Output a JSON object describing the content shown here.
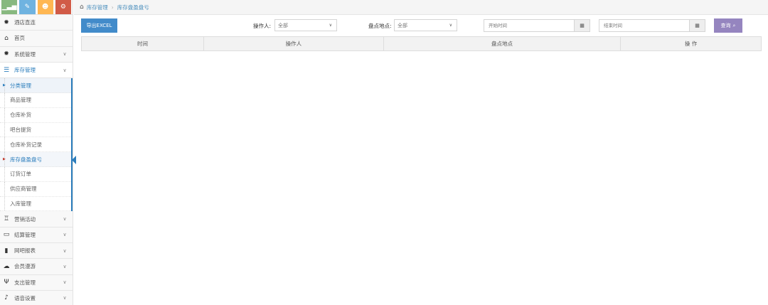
{
  "colors": {
    "accent": "#2b7dbc",
    "excel_button": "#428bca",
    "query_button": "#9585bf",
    "shortcut_green": "#87b87f",
    "shortcut_blue": "#6fb3e0",
    "shortcut_orange": "#ffb752",
    "shortcut_red": "#d15b47"
  },
  "shortcuts": [
    {
      "icon": "bar-chart-icon",
      "glyph": "▁▃▅"
    },
    {
      "icon": "pencil-icon",
      "glyph": "✎"
    },
    {
      "icon": "users-icon",
      "glyph": "☻"
    },
    {
      "icon": "cogs-icon",
      "glyph": "⚙"
    }
  ],
  "sidebar": {
    "top_items": [
      {
        "label": "酒店直连",
        "icon": "gear-icon",
        "glyph": "✹"
      },
      {
        "label": "首页",
        "icon": "home-icon",
        "glyph": "⌂"
      },
      {
        "label": "系统管理",
        "icon": "gear-icon",
        "glyph": "✹"
      }
    ],
    "open_menu": {
      "label": "库存管理",
      "icon": "database-icon",
      "glyph": "☰"
    },
    "sub_items": [
      {
        "label": "分类管理"
      },
      {
        "label": "商品管理"
      },
      {
        "label": "仓库补货"
      },
      {
        "label": "吧台提货"
      },
      {
        "label": "仓库补货记录"
      },
      {
        "label": "库存盘盈盘亏"
      },
      {
        "label": "订货订单"
      },
      {
        "label": "供应商管理"
      },
      {
        "label": "入库管理"
      }
    ],
    "bottom_items": [
      {
        "label": "营销活动",
        "icon": "gift-icon",
        "glyph": "♖"
      },
      {
        "label": "结算管理",
        "icon": "credit-card-icon",
        "glyph": "▭"
      },
      {
        "label": "网吧报表",
        "icon": "bar-chart-icon",
        "glyph": "▮"
      },
      {
        "label": "会员漫游",
        "icon": "cloud-icon",
        "glyph": "☁"
      },
      {
        "label": "支出管理",
        "icon": "cutlery-icon",
        "glyph": "Ψ"
      },
      {
        "label": "语音设置",
        "icon": "bell-icon",
        "glyph": "♪"
      }
    ]
  },
  "breadcrumb": {
    "items": [
      "库存管理",
      "库存盘盈盘亏"
    ]
  },
  "toolbar": {
    "export_label": "导出EXCEL",
    "operator_label": "操作人:",
    "operator_value": "全部",
    "location_label": "盘点地点:",
    "location_value": "全部",
    "start_placeholder": "开始时间",
    "end_placeholder": "结束时间",
    "query_label": "查询"
  },
  "table": {
    "headers": [
      "时间",
      "操作人",
      "盘点地点",
      "操 作"
    ]
  }
}
